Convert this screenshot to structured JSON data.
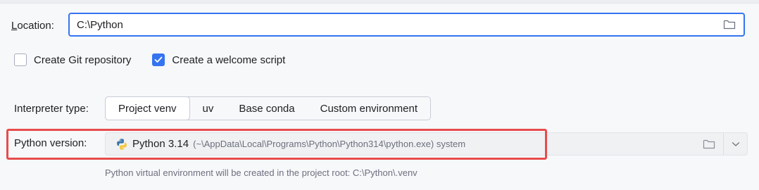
{
  "location": {
    "label_mnemonic": "L",
    "label_rest": "ocation:",
    "value": "C:\\Python",
    "folder_icon": "folder-icon"
  },
  "checkboxes": [
    {
      "label": "Create Git repository",
      "checked": false
    },
    {
      "label": "Create a welcome script",
      "checked": true
    }
  ],
  "interpreter": {
    "label": "Interpreter type:",
    "options": [
      "Project venv",
      "uv",
      "Base conda",
      "Custom environment"
    ],
    "selected": "Project venv"
  },
  "python_version": {
    "label": "Python version:",
    "name": "Python 3.14",
    "path": "(~\\AppData\\Local\\Programs\\Python\\Python314\\python.exe) system",
    "icon": "python-icon"
  },
  "hint": "Python virtual environment will be created in the project root: C:\\Python\\.venv",
  "colors": {
    "accent": "#3574f0",
    "highlight": "#e74c4c"
  }
}
